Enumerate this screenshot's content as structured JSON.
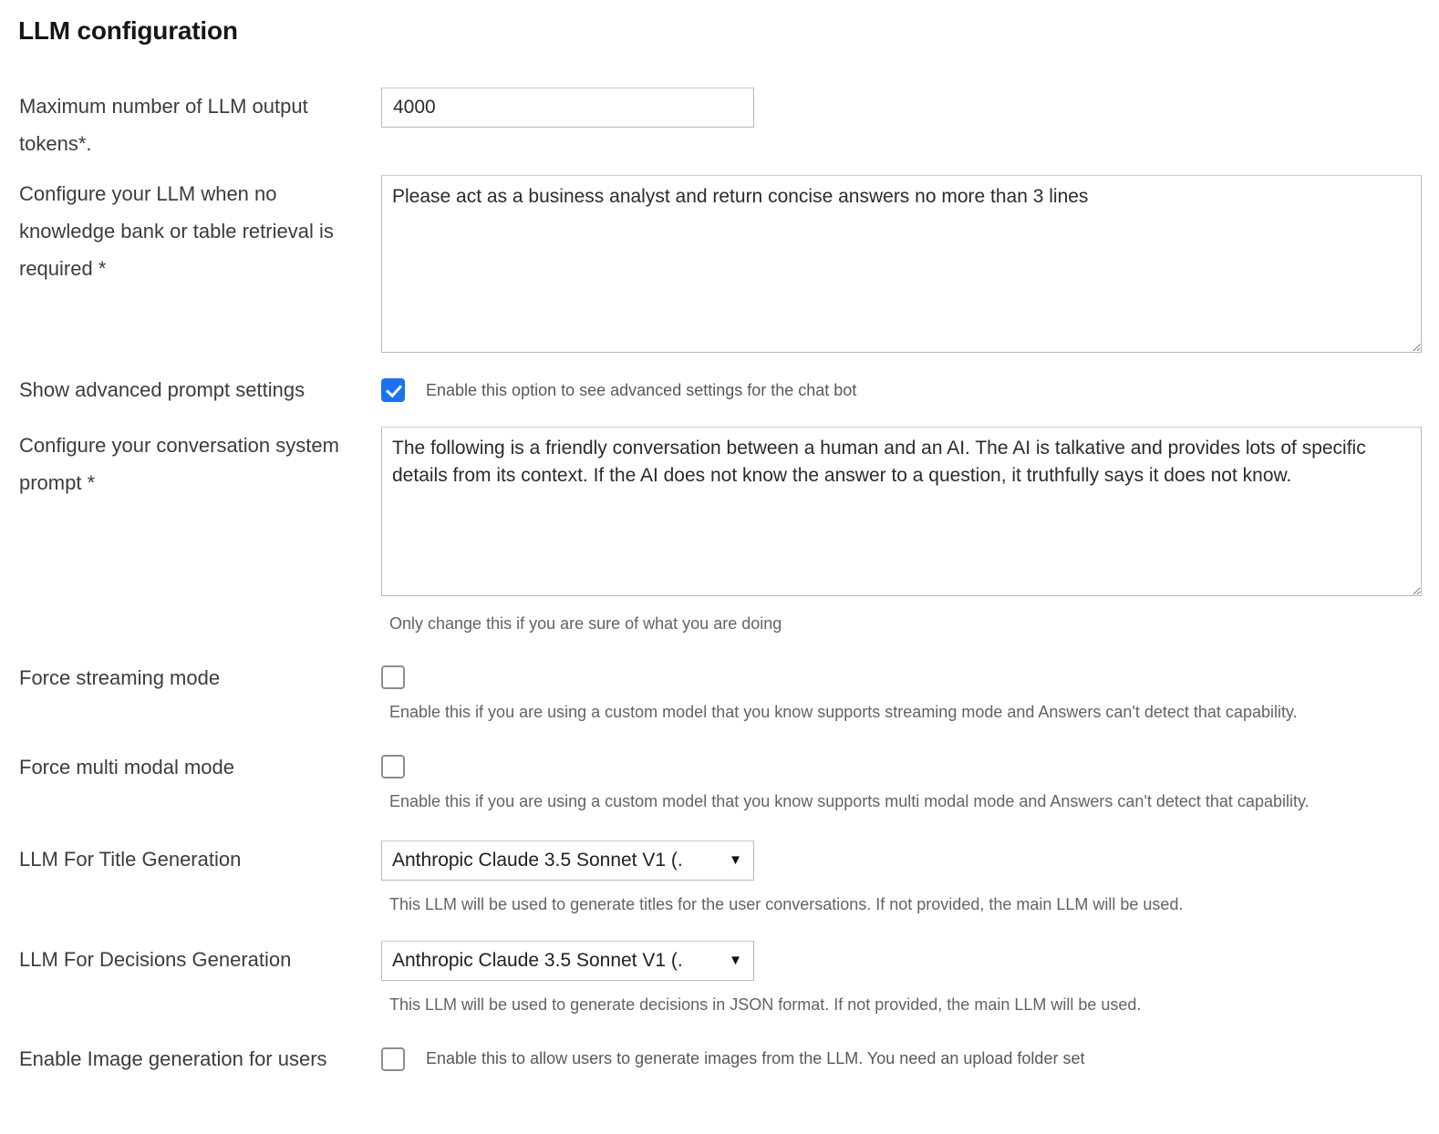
{
  "section": {
    "title": "LLM configuration"
  },
  "fields": {
    "max_tokens": {
      "label": "Maximum number of LLM output tokens*.",
      "value": "4000",
      "placeholder": ""
    },
    "no_retrieval_prompt": {
      "label": "Configure your LLM when no knowledge bank or table retrieval is required *",
      "value": "Please act as a business analyst and return concise answers no more than 3 lines",
      "placeholder": ""
    },
    "show_advanced": {
      "label": "Show advanced prompt settings",
      "caption": "Enable this option to see advanced settings for the chat bot",
      "checked": true
    },
    "conversation_system_prompt": {
      "label": "Configure your conversation system prompt *",
      "value": "The following is a friendly conversation between a human and an AI. The AI is talkative and provides lots of specific details from its context. If the AI does not know the answer to a question, it truthfully says it does not know.",
      "help": "Only change this if you are sure of what you are doing",
      "placeholder": ""
    },
    "force_streaming": {
      "label": "Force streaming mode",
      "help": "Enable this if you are using a custom model that you know supports streaming mode and Answers can't detect that capability.",
      "checked": false
    },
    "force_multi_modal": {
      "label": "Force multi modal mode",
      "help": "Enable this if you are using a custom model that you know supports multi modal mode and Answers can't detect that capability.",
      "checked": false
    },
    "llm_title_generation": {
      "label": "LLM For Title Generation",
      "selected": "Anthropic Claude 3.5 Sonnet V1 (.",
      "arrow": "▼",
      "help": "This LLM will be used to generate titles for the user conversations. If not provided, the main LLM will be used."
    },
    "llm_decisions_generation": {
      "label": "LLM For Decisions Generation",
      "selected": "Anthropic Claude 3.5 Sonnet V1 (.",
      "arrow": "▼",
      "help": "This LLM will be used to generate decisions in JSON format. If not provided, the main LLM will be used."
    },
    "enable_image_generation": {
      "label": "Enable Image generation for users",
      "caption": "Enable this to allow users to generate images from the LLM. You need an upload folder set",
      "checked": false
    }
  },
  "colors": {
    "accent": "#1a73f0",
    "label_text": "#3c3c3c",
    "help_text": "#636363",
    "border": "#b9b9b9"
  }
}
